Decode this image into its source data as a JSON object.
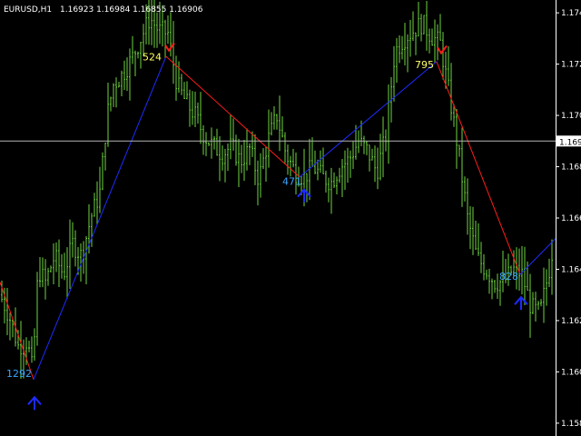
{
  "header": {
    "symbol": "EURUSD,H1",
    "ohlc": "1.16923 1.16984 1.16855 1.16906"
  },
  "colors": {
    "background": "#000000",
    "bars": "#6fd33f",
    "zigzag_up": "#1f2bff",
    "zigzag_down": "#ff1c1c",
    "buy_arrow": "#1f2bff",
    "sell_arrow": "#ff1c1c",
    "label_top": "#ffff66",
    "label_bottom": "#3aa4ff",
    "price_line": "#b4b4b4",
    "axis": "#ffffff"
  },
  "chart_data": {
    "type": "ohlc",
    "symbol": "EURUSD",
    "timeframe": "H1",
    "ylim": [
      1.1575,
      1.1745
    ],
    "y_ticks": [
      "1.1580",
      "1.1600",
      "1.1620",
      "1.1640",
      "1.1660",
      "1.1680",
      "1.1700",
      "1.1720",
      "1.1740"
    ],
    "current_price": "1.1690",
    "close_path": [
      [
        0,
        1.163
      ],
      [
        10,
        1.1622
      ],
      [
        20,
        1.161
      ],
      [
        30,
        1.1612
      ],
      [
        36,
        1.16
      ],
      [
        42,
        1.164
      ],
      [
        50,
        1.1635
      ],
      [
        60,
        1.1645
      ],
      [
        70,
        1.1638
      ],
      [
        80,
        1.165
      ],
      [
        90,
        1.1645
      ],
      [
        100,
        1.166
      ],
      [
        110,
        1.167
      ],
      [
        118,
        1.17
      ],
      [
        125,
        1.1712
      ],
      [
        135,
        1.1716
      ],
      [
        145,
        1.1722
      ],
      [
        155,
        1.173
      ],
      [
        165,
        1.1738
      ],
      [
        175,
        1.1733
      ],
      [
        185,
        1.1732
      ],
      [
        195,
        1.1712
      ],
      [
        205,
        1.1705
      ],
      [
        215,
        1.17
      ],
      [
        225,
        1.1692
      ],
      [
        235,
        1.1688
      ],
      [
        245,
        1.1685
      ],
      [
        255,
        1.1688
      ],
      [
        265,
        1.1682
      ],
      [
        275,
        1.1687
      ],
      [
        285,
        1.1675
      ],
      [
        295,
        1.169
      ],
      [
        305,
        1.17
      ],
      [
        315,
        1.1685
      ],
      [
        325,
        1.1678
      ],
      [
        335,
        1.1676
      ],
      [
        345,
        1.168
      ],
      [
        355,
        1.1676
      ],
      [
        365,
        1.1674
      ],
      [
        375,
        1.168
      ],
      [
        385,
        1.1683
      ],
      [
        395,
        1.169
      ],
      [
        405,
        1.1686
      ],
      [
        415,
        1.1678
      ],
      [
        425,
        1.1692
      ],
      [
        435,
        1.1725
      ],
      [
        445,
        1.173
      ],
      [
        455,
        1.1733
      ],
      [
        465,
        1.1736
      ],
      [
        475,
        1.1731
      ],
      [
        485,
        1.1728
      ],
      [
        495,
        1.1708
      ],
      [
        505,
        1.1686
      ],
      [
        515,
        1.166
      ],
      [
        525,
        1.1645
      ],
      [
        535,
        1.164
      ],
      [
        545,
        1.1635
      ],
      [
        555,
        1.1635
      ],
      [
        565,
        1.164
      ],
      [
        575,
        1.1638
      ],
      [
        585,
        1.1625
      ],
      [
        595,
        1.1623
      ],
      [
        605,
        1.164
      ],
      [
        612,
        1.1655
      ]
    ],
    "zigzag": [
      {
        "x": 0,
        "y": 1.1635
      },
      {
        "x": 37,
        "y": 1.1597
      },
      {
        "x": 183,
        "y": 1.1723
      },
      {
        "x": 330,
        "y": 1.1676
      },
      {
        "x": 481,
        "y": 1.1721
      },
      {
        "x": 573,
        "y": 1.1638
      },
      {
        "x": 612,
        "y": 1.1652
      }
    ],
    "signals": [
      {
        "type": "buy",
        "x": 38,
        "y": 1.1588,
        "label": "1292",
        "label_y": 1.1598
      },
      {
        "type": "sell",
        "x": 188,
        "y": 1.1726,
        "label": "524",
        "label_y": 1.1725
      },
      {
        "type": "buy",
        "x": 335,
        "y": 1.1669,
        "label": "471",
        "label_y": 1.1673
      },
      {
        "type": "sell",
        "x": 488,
        "y": 1.1725,
        "label": "795",
        "label_y": 1.1722
      },
      {
        "type": "buy",
        "x": 574,
        "y": 1.1627,
        "label": "828",
        "label_y": 1.1636
      }
    ]
  }
}
